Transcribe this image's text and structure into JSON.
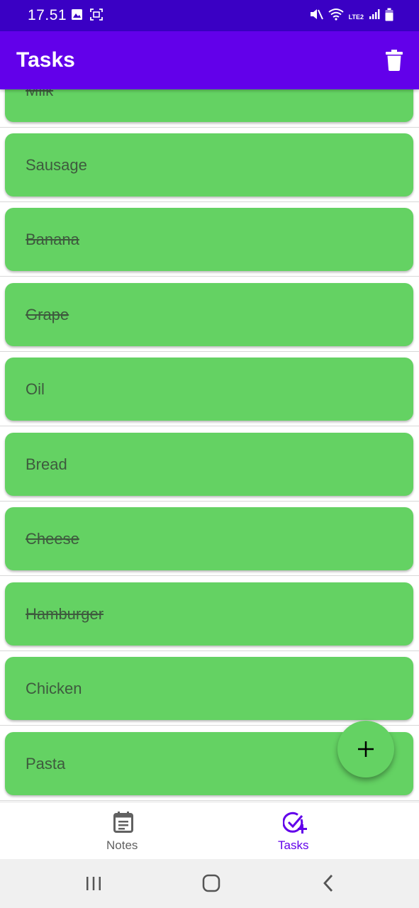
{
  "status_bar": {
    "time": "17.51",
    "network_label": "LTE2"
  },
  "app_bar": {
    "title": "Tasks",
    "delete_icon": "trash-icon"
  },
  "colors": {
    "status_bar": "#3a00c4",
    "app_bar": "#6200ea",
    "card": "#64d263",
    "accent": "#6200ea",
    "text_on_card": "#3e5a3e"
  },
  "tasks": [
    {
      "label": "Milk",
      "done": true
    },
    {
      "label": "Sausage",
      "done": false
    },
    {
      "label": "Banana",
      "done": true
    },
    {
      "label": "Grape",
      "done": true
    },
    {
      "label": "Oil",
      "done": false
    },
    {
      "label": "Bread",
      "done": false
    },
    {
      "label": "Cheese",
      "done": true
    },
    {
      "label": "Hamburger ",
      "done": true
    },
    {
      "label": "Chicken",
      "done": false
    },
    {
      "label": "Pasta",
      "done": false
    }
  ],
  "fab": {
    "icon": "plus-icon"
  },
  "bottom_nav": {
    "items": [
      {
        "label": "Notes",
        "icon": "calendar-note-icon",
        "active": false
      },
      {
        "label": "Tasks",
        "icon": "check-add-icon",
        "active": true
      }
    ]
  },
  "system_nav": {
    "recent": "recent-apps-icon",
    "home": "home-icon",
    "back": "back-icon"
  }
}
